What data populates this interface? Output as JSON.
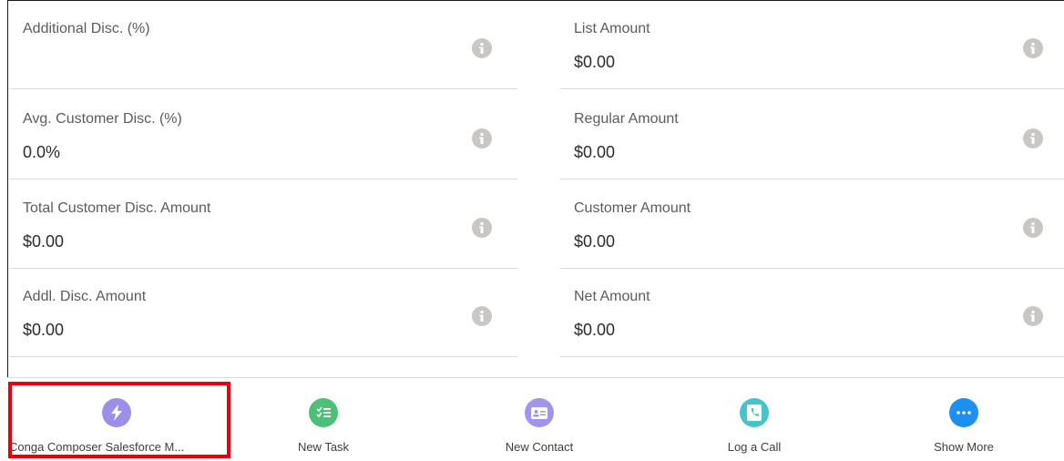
{
  "fields": {
    "left": [
      {
        "label": "Additional Disc. (%)",
        "value": ""
      },
      {
        "label": "Avg. Customer Disc. (%)",
        "value": "0.0%"
      },
      {
        "label": "Total Customer Disc. Amount",
        "value": "$0.00"
      },
      {
        "label": "Addl. Disc. Amount",
        "value": "$0.00"
      }
    ],
    "right": [
      {
        "label": "List Amount",
        "value": "$0.00"
      },
      {
        "label": "Regular Amount",
        "value": "$0.00"
      },
      {
        "label": "Customer Amount",
        "value": "$0.00"
      },
      {
        "label": "Net Amount",
        "value": "$0.00"
      }
    ]
  },
  "actions": [
    {
      "label": "Conga Composer Salesforce M...",
      "icon": "lightning-icon",
      "color": "#9b8fe8"
    },
    {
      "label": "New Task",
      "icon": "task-icon",
      "color": "#4bc076"
    },
    {
      "label": "New Contact",
      "icon": "contact-card-icon",
      "color": "#a094ed"
    },
    {
      "label": "Log a Call",
      "icon": "phone-log-icon",
      "color": "#48c3cc"
    },
    {
      "label": "Show More",
      "icon": "more-icon",
      "color": "#1b8ff2"
    }
  ],
  "colors": {
    "highlight": "#e8000c",
    "info_icon": "#c9c7c5"
  }
}
